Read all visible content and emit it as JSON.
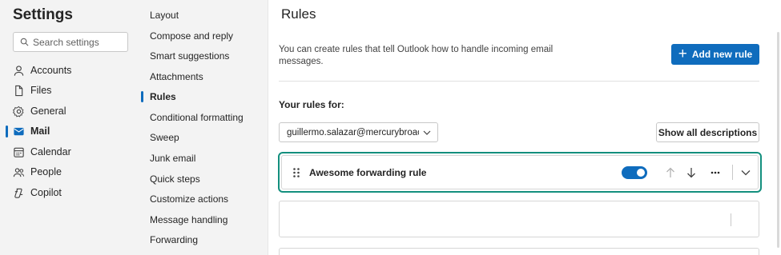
{
  "settings": {
    "title": "Settings",
    "search_placeholder": "Search settings"
  },
  "left_nav": [
    {
      "label": "Accounts",
      "icon": "person-icon"
    },
    {
      "label": "Files",
      "icon": "file-icon"
    },
    {
      "label": "General",
      "icon": "gear-icon"
    },
    {
      "label": "Mail",
      "icon": "mail-icon",
      "active": true
    },
    {
      "label": "Calendar",
      "icon": "calendar-icon"
    },
    {
      "label": "People",
      "icon": "people-icon"
    },
    {
      "label": "Copilot",
      "icon": "copilot-icon"
    }
  ],
  "mail_nav": [
    {
      "label": "Layout"
    },
    {
      "label": "Compose and reply"
    },
    {
      "label": "Smart suggestions"
    },
    {
      "label": "Attachments"
    },
    {
      "label": "Rules",
      "active": true
    },
    {
      "label": "Conditional formatting"
    },
    {
      "label": "Sweep"
    },
    {
      "label": "Junk email"
    },
    {
      "label": "Quick steps"
    },
    {
      "label": "Customize actions"
    },
    {
      "label": "Message handling"
    },
    {
      "label": "Forwarding"
    }
  ],
  "rules": {
    "title": "Rules",
    "description": "You can create rules that tell Outlook how to handle incoming email messages.",
    "add_button": "Add new rule",
    "rules_for_label": "Your rules for:",
    "account": "guillermo.salazar@mercurybroac",
    "show_all_button": "Show all descriptions",
    "items": [
      {
        "name": "Awesome forwarding rule",
        "enabled": true
      }
    ]
  },
  "colors": {
    "accent": "#0f6cbd",
    "highlight": "#138f7e",
    "nav_bg": "#f3f3f3"
  }
}
